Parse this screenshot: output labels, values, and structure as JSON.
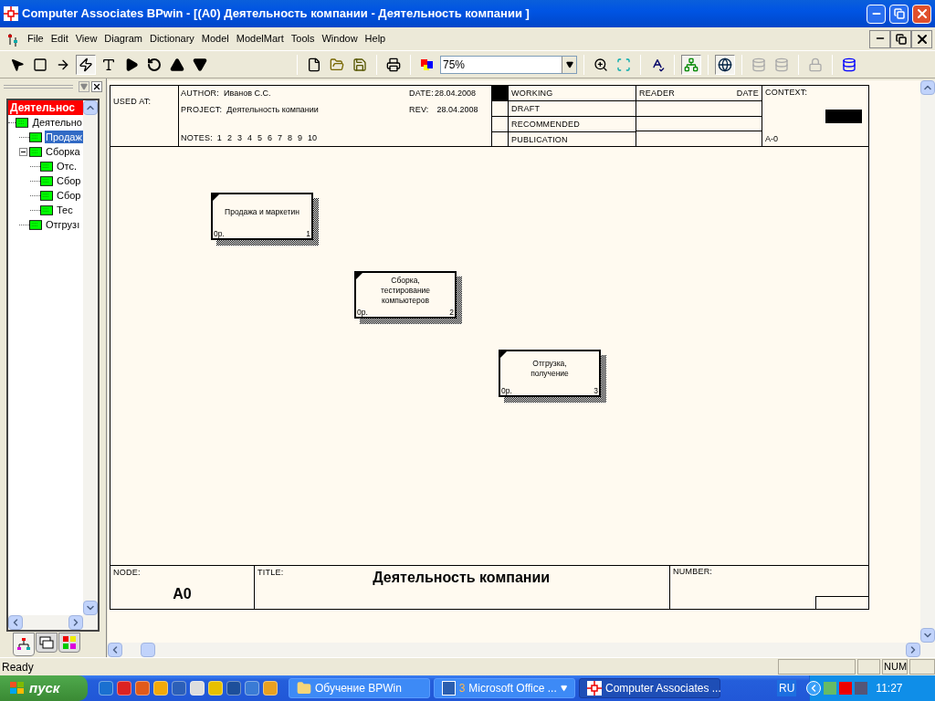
{
  "window": {
    "title": "Computer Associates BPwin - [(A0) Деятельность компании - Деятельность компании ]"
  },
  "menu": [
    "File",
    "Edit",
    "View",
    "Diagram",
    "Dictionary",
    "Model",
    "ModelMart",
    "Tools",
    "Window",
    "Help"
  ],
  "tools": [
    {
      "kind": "pointer",
      "selected": false
    },
    {
      "kind": "box",
      "selected": false
    },
    {
      "kind": "arrow",
      "selected": false
    },
    {
      "kind": "squiggle",
      "selected": true
    },
    {
      "kind": "text",
      "selected": false
    },
    {
      "kind": "play",
      "selected": false
    },
    {
      "kind": "rotate",
      "selected": false
    },
    {
      "kind": "up",
      "selected": false
    },
    {
      "kind": "down",
      "selected": false
    }
  ],
  "zoom": "75%",
  "buttons": [
    {
      "kind": "zoom-in",
      "selected": false
    },
    {
      "kind": "zoom-fit",
      "selected": false
    },
    {
      "kind": "spell",
      "selected": false
    },
    {
      "kind": "tree",
      "selected": true
    },
    {
      "kind": "globe",
      "selected": true
    }
  ],
  "tree": {
    "title": "Деятельнос",
    "items": [
      {
        "label": "Деятельно",
        "selected": false,
        "children": [
          {
            "label": "Продаж",
            "selected": true
          },
          {
            "label": "Сборка",
            "selected": false,
            "expanded": true,
            "children": [
              {
                "label": "Отс.",
                "selected": false
              },
              {
                "label": "Сбор",
                "selected": false
              },
              {
                "label": "Сбор",
                "selected": false
              },
              {
                "label": "Тес",
                "selected": false
              }
            ]
          },
          {
            "label": "Отгрузı",
            "selected": false
          }
        ]
      }
    ]
  },
  "panel_tabs": [
    {
      "kind": "activities",
      "selected": true
    },
    {
      "kind": "objects",
      "selected": false
    },
    {
      "kind": "diagrams",
      "selected": false
    }
  ],
  "form": {
    "used_at_label": "USED AT:",
    "author_label": "AUTHOR:",
    "author": "Иванов С.С.",
    "project_label": "PROJECT:",
    "project": "Деятельность компании",
    "notes_label": "NOTES:",
    "notes": [
      "1",
      "2",
      "3",
      "4",
      "5",
      "6",
      "7",
      "8",
      "9",
      "10"
    ],
    "date_label": "DATE:",
    "date": "28.04.2008",
    "rev_label": "REV:",
    "rev": "28.04.2008",
    "statuses": [
      {
        "label": "WORKING",
        "selected": true
      },
      {
        "label": "DRAFT",
        "selected": false
      },
      {
        "label": "RECOMMENDED",
        "selected": false
      },
      {
        "label": "PUBLICATION",
        "selected": false
      }
    ],
    "reader_label": "READER",
    "reader_date_label": "DATE",
    "context_label": "CONTEXT:",
    "context_node": "A-0",
    "node_label": "NODE:",
    "node": "A0",
    "title_label": "TITLE:",
    "title": "Деятельность компании",
    "number_label": "NUMBER:"
  },
  "activities": [
    {
      "name": "Продажа и маркетин",
      "cost": "0р.",
      "number": "1"
    },
    {
      "name": "Сборка, тестирование компьютеров",
      "cost": "0р.",
      "number": "2"
    },
    {
      "name": "Отгрузка, получение",
      "cost": "0р.",
      "number": "3"
    }
  ],
  "status_bar": {
    "text": "Ready",
    "num": "NUM"
  },
  "taskbar": {
    "start": "пуск",
    "tasks": [
      {
        "kind": "folder",
        "label": "Обучение BPWin",
        "selected": false
      },
      {
        "kind": "word",
        "count": "3",
        "label": "Microsoft Office ...",
        "selected": false
      },
      {
        "kind": "bpwin",
        "label": "Computer Associates ...",
        "selected": true
      }
    ],
    "lang": "RU",
    "clock": "11:27"
  }
}
